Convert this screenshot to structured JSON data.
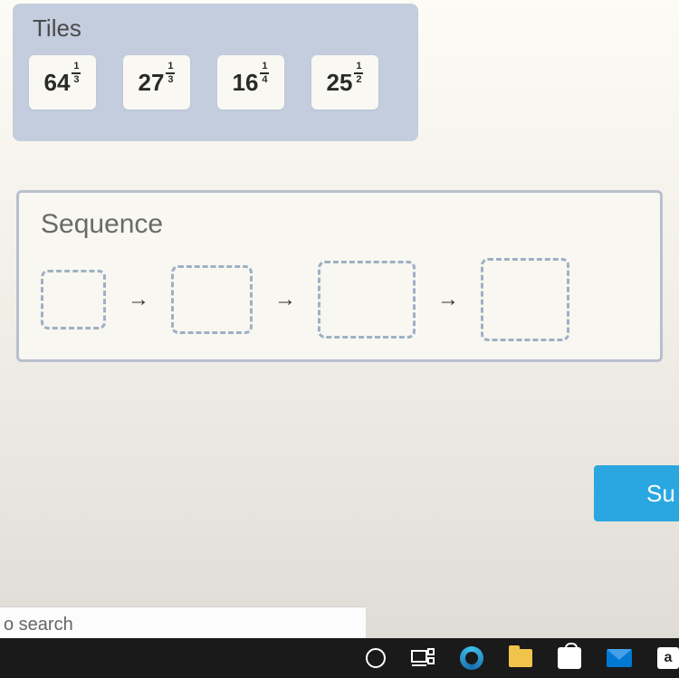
{
  "tiles": {
    "title": "Tiles",
    "items": [
      {
        "base": "64",
        "num": "1",
        "den": "3"
      },
      {
        "base": "27",
        "num": "1",
        "den": "3"
      },
      {
        "base": "16",
        "num": "1",
        "den": "4"
      },
      {
        "base": "25",
        "num": "1",
        "den": "2"
      }
    ]
  },
  "sequence": {
    "title": "Sequence",
    "arrow": "→"
  },
  "submit_label": "Su",
  "search_placeholder": "o search",
  "taskbar": {
    "amazon_label": "a"
  }
}
